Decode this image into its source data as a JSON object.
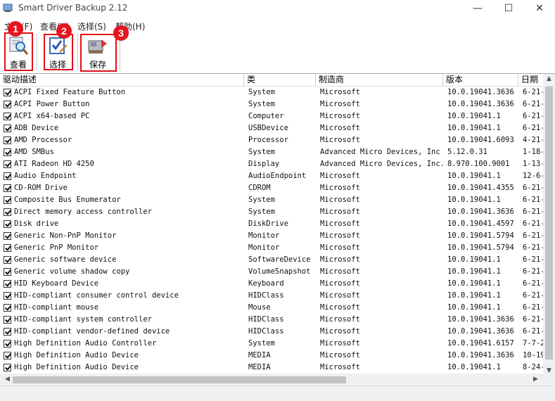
{
  "window": {
    "title": "Smart Driver Backup 2.12",
    "minimize_label": "—",
    "maximize_label": "☐",
    "close_label": "✕"
  },
  "menu": [
    "文件(F)",
    "查看(V)",
    "选择(S)",
    "帮助(H)"
  ],
  "toolbar": {
    "view_label": "查看",
    "select_label": "选择",
    "save_label": "保存",
    "badges": [
      "1",
      "2",
      "3"
    ],
    "highlight_color": "#e0101a"
  },
  "columns": [
    "驱动描述",
    "类",
    "制造商",
    "版本",
    "日期"
  ],
  "rows": [
    {
      "name": "ACPI Fixed Feature Button",
      "class": "System",
      "mfr": "Microsoft",
      "version": "10.0.19041.3636",
      "date": "6-21-"
    },
    {
      "name": "ACPI Power Button",
      "class": "System",
      "mfr": "Microsoft",
      "version": "10.0.19041.3636",
      "date": "6-21-"
    },
    {
      "name": "ACPI x64-based PC",
      "class": "Computer",
      "mfr": "Microsoft",
      "version": "10.0.19041.1",
      "date": "6-21-"
    },
    {
      "name": "ADB Device",
      "class": "USBDevice",
      "mfr": "Microsoft",
      "version": "10.0.19041.1",
      "date": "6-21-"
    },
    {
      "name": "AMD Processor",
      "class": "Processor",
      "mfr": "Microsoft",
      "version": "10.0.19041.6093",
      "date": "4-21-"
    },
    {
      "name": "AMD SMBus",
      "class": "System",
      "mfr": "Advanced Micro Devices, Inc",
      "version": "5.12.0.31",
      "date": "1-18-"
    },
    {
      "name": "ATI Radeon HD 4250",
      "class": "Display",
      "mfr": "Advanced Micro Devices, Inc.",
      "version": "8.970.100.9001",
      "date": "1-13-"
    },
    {
      "name": "Audio Endpoint",
      "class": "AudioEndpoint",
      "mfr": "Microsoft",
      "version": "10.0.19041.1",
      "date": "12-6-"
    },
    {
      "name": "CD-ROM Drive",
      "class": "CDROM",
      "mfr": "Microsoft",
      "version": "10.0.19041.4355",
      "date": "6-21-"
    },
    {
      "name": "Composite Bus Enumerator",
      "class": "System",
      "mfr": "Microsoft",
      "version": "10.0.19041.1",
      "date": "6-21-"
    },
    {
      "name": "Direct memory access controller",
      "class": "System",
      "mfr": "Microsoft",
      "version": "10.0.19041.3636",
      "date": "6-21-"
    },
    {
      "name": "Disk drive",
      "class": "DiskDrive",
      "mfr": "Microsoft",
      "version": "10.0.19041.4597",
      "date": "6-21-"
    },
    {
      "name": "Generic Non-PnP Monitor",
      "class": "Monitor",
      "mfr": "Microsoft",
      "version": "10.0.19041.5794",
      "date": "6-21-"
    },
    {
      "name": "Generic PnP Monitor",
      "class": "Monitor",
      "mfr": "Microsoft",
      "version": "10.0.19041.5794",
      "date": "6-21-"
    },
    {
      "name": "Generic software device",
      "class": "SoftwareDevice",
      "mfr": "Microsoft",
      "version": "10.0.19041.1",
      "date": "6-21-"
    },
    {
      "name": "Generic volume shadow copy",
      "class": "VolumeSnapshot",
      "mfr": "Microsoft",
      "version": "10.0.19041.1",
      "date": "6-21-"
    },
    {
      "name": "HID Keyboard Device",
      "class": "Keyboard",
      "mfr": "Microsoft",
      "version": "10.0.19041.1",
      "date": "6-21-"
    },
    {
      "name": "HID-compliant consumer control device",
      "class": "HIDClass",
      "mfr": "Microsoft",
      "version": "10.0.19041.1",
      "date": "6-21-"
    },
    {
      "name": "HID-compliant mouse",
      "class": "Mouse",
      "mfr": "Microsoft",
      "version": "10.0.19041.1",
      "date": "6-21-"
    },
    {
      "name": "HID-compliant system controller",
      "class": "HIDClass",
      "mfr": "Microsoft",
      "version": "10.0.19041.3636",
      "date": "6-21-"
    },
    {
      "name": "HID-compliant vendor-defined device",
      "class": "HIDClass",
      "mfr": "Microsoft",
      "version": "10.0.19041.3636",
      "date": "6-21-"
    },
    {
      "name": "High Definition Audio Controller",
      "class": "System",
      "mfr": "Microsoft",
      "version": "10.0.19041.6157",
      "date": "7-7-2"
    },
    {
      "name": "High Definition Audio Device",
      "class": "MEDIA",
      "mfr": "Microsoft",
      "version": "10.0.19041.3636",
      "date": "10-19"
    },
    {
      "name": "High Definition Audio Device",
      "class": "MEDIA",
      "mfr": "Microsoft",
      "version": "10.0.19041.1",
      "date": "8-24-"
    }
  ]
}
